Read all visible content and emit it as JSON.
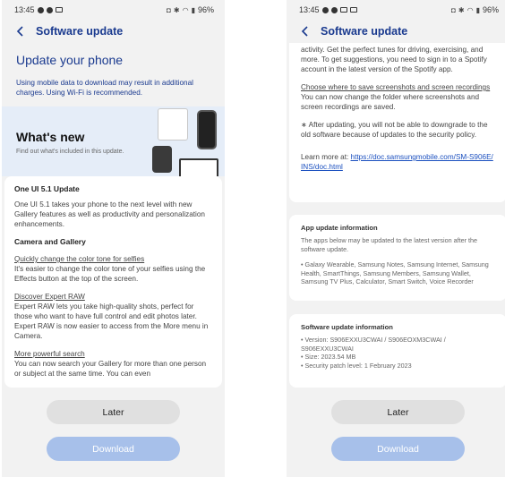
{
  "left": {
    "status": {
      "time": "13:45",
      "battery": "96%"
    },
    "header": {
      "title": "Software update"
    },
    "title": "Update your phone",
    "notice": "Using mobile data to download may result in additional charges. Using Wi-Fi is recommended.",
    "banner": {
      "title": "What's new",
      "subtitle": "Find out what's included in this update."
    },
    "content": {
      "update_title": "One UI 5.1 Update",
      "update_desc": "One UI 5.1 takes your phone to the next level with new Gallery features as well as productivity and personalization enhancements.",
      "section_title": "Camera and Gallery",
      "item1_link": "Quickly change the color tone for selfies",
      "item1_desc": "It's easier to change the color tone of your selfies using the Effects button at the top of the screen.",
      "item2_link": "Discover Expert RAW",
      "item2_desc": "Expert RAW lets you take high-quality shots, perfect for those who want to have full control and edit photos later. Expert RAW is now easier to access from the More menu in Camera.",
      "item3_link": "More powerful search",
      "item3_desc": "You can now search your Gallery for more than one person or subject at the same time. You can even"
    },
    "buttons": {
      "later": "Later",
      "download": "Download"
    }
  },
  "right": {
    "status": {
      "time": "13:45",
      "battery": "96%"
    },
    "header": {
      "title": "Software update"
    },
    "content": {
      "spotify_text": "activity. Get the perfect tunes for driving, exercising, and more. To get suggestions, you need to sign in to a Spotify account in the latest version of the Spotify app.",
      "save_link": "Choose where to save screenshots and screen recordings",
      "save_desc": "You can now change the folder where screenshots and screen recordings are saved.",
      "downgrade_note": "∗ After updating, you will not be able to downgrade to the old software because of updates to the security policy.",
      "learn_more_label": "Learn more at: ",
      "learn_more_url": "https://doc.samsungmobile.com/SM-S906E/INS/doc.html"
    },
    "app_update": {
      "title": "App update information",
      "desc": "The apps below may be updated to the latest version after the software update.",
      "apps": "• Galaxy Wearable, Samsung Notes, Samsung Internet, Samsung Health, SmartThings, Samsung Members, Samsung Wallet, Samsung TV Plus, Calculator, Smart Switch, Voice Recorder"
    },
    "sw_info": {
      "title": "Software update information",
      "version": "• Version: S906EXXU3CWAI / S906EOXM3CWAI / S906EXXU3CWAI",
      "size": "• Size: 2023.54 MB",
      "patch": "• Security patch level: 1 February 2023"
    },
    "buttons": {
      "later": "Later",
      "download": "Download"
    }
  }
}
